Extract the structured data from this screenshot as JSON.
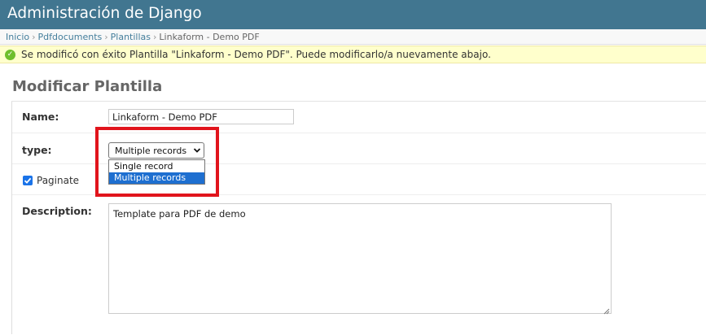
{
  "header": {
    "title": "Administración de Django"
  },
  "breadcrumbs": {
    "items": [
      "Inicio",
      "Pdfdocuments",
      "Plantillas"
    ],
    "current": "Linkaform - Demo PDF",
    "separator": "›"
  },
  "message": {
    "icon": "success-check-icon",
    "text": "Se modificó con éxito Plantilla \"Linkaform - Demo PDF\". Puede modificarlo/a nuevamente abajo."
  },
  "page": {
    "title": "Modificar Plantilla"
  },
  "form": {
    "name_label": "Name:",
    "name_value": "Linkaform - Demo PDF",
    "type_label": "type:",
    "type_selected": "Multiple records",
    "type_options": [
      "Single record",
      "Multiple records"
    ],
    "paginate_label": "Paginate",
    "paginate_checked": true,
    "description_label": "Description:",
    "description_value": "Template para PDF de demo"
  },
  "colors": {
    "header_bg": "#417690",
    "link": "#447e9b",
    "message_bg": "#ffffcc",
    "success": "#70bf2b",
    "highlight": "#e1141c",
    "option_selected": "#1e6fd0"
  }
}
